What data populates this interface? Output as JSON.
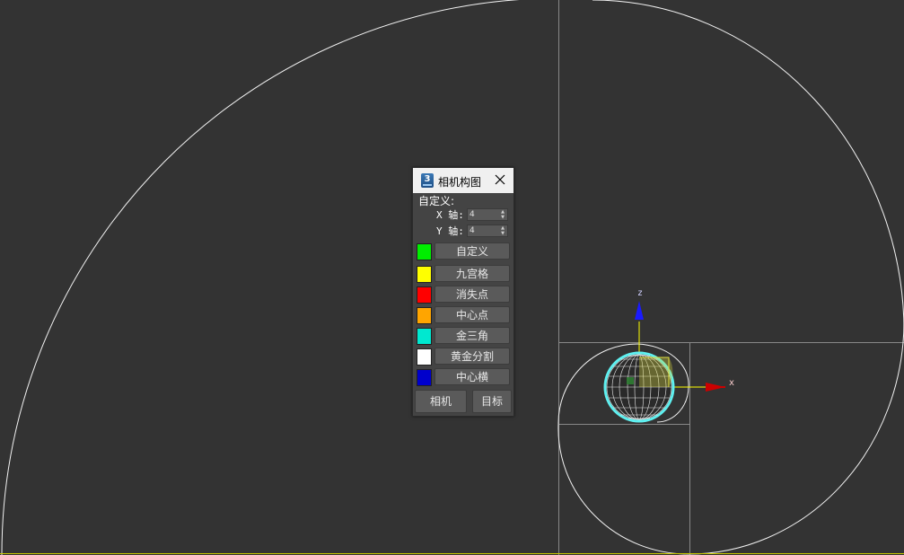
{
  "viewport": {
    "axis_labels": {
      "x": "x",
      "z": "z"
    }
  },
  "panel": {
    "title": "相机构图",
    "icon": "3ds-max-icon",
    "custom_label": "自定义:",
    "x_axis": {
      "label": "X 轴:",
      "value": "4"
    },
    "y_axis": {
      "label": "Y 轴:",
      "value": "4"
    },
    "guides": [
      {
        "label": "自定义",
        "color": "#00ee00"
      },
      {
        "label": "九宫格",
        "color": "#ffff00"
      },
      {
        "label": "消失点",
        "color": "#ff0000"
      },
      {
        "label": "中心点",
        "color": "#ffa500"
      },
      {
        "label": "金三角",
        "color": "#00e8d0"
      },
      {
        "label": "黄金分割",
        "color": "#ffffff"
      },
      {
        "label": "中心横",
        "color": "#0000cc"
      }
    ],
    "camera_button": "相机",
    "target_button": "目标"
  }
}
